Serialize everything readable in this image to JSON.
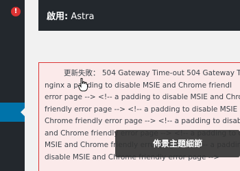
{
  "theme_bar": {
    "label": "啟用:",
    "theme_name": "Astra"
  },
  "error": {
    "icon": "exclamation-icon",
    "lines": [
      "更新失敗： 504 Gateway Time-out 504 Gateway Ti",
      "nginx     a padding to disable MSIE and Chrome friendl",
      "error page --> <!-- a padding to disable MSIE and Chro",
      "friendly error page --> <!-- a padding to disable MSIE a",
      "Chrome friendly error page --> <!-- a padding to disable",
      "and Chrome friendly error page --> <!-- a padding to d",
      "MSIE and Chrome friendly error page --> <!-- a padding",
      "disable MSIE and Chrome friendly error page -->"
    ]
  },
  "tooltip": {
    "label": "佈景主題細節"
  },
  "colors": {
    "sidebar": "#23282d",
    "accent": "#0073aa",
    "error_red": "#dc3232",
    "error_bg": "#fbeaea"
  }
}
